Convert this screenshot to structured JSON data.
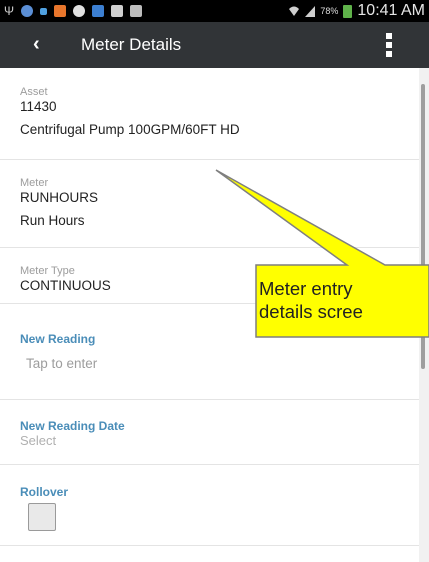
{
  "status_bar": {
    "battery_percent": "78%",
    "time": "10:41 AM",
    "icons": [
      "usb-icon",
      "app-circle-icon",
      "app-square-icon",
      "app-orange-icon",
      "cloud-icon",
      "app-blue-icon",
      "document-icon",
      "image-icon",
      "wifi-icon",
      "signal-icon",
      "battery-icon"
    ]
  },
  "app_bar": {
    "back_glyph": "‹",
    "title": "Meter Details"
  },
  "asset": {
    "label": "Asset",
    "number": "11430",
    "description": "Centrifugal Pump 100GPM/60FT HD"
  },
  "meter": {
    "label": "Meter",
    "code": "RUNHOURS",
    "description": "Run Hours"
  },
  "meter_type": {
    "label": "Meter Type",
    "value": "CONTINUOUS"
  },
  "new_reading": {
    "label": "New Reading",
    "placeholder": "Tap to enter"
  },
  "new_reading_date": {
    "label": "New Reading Date",
    "placeholder": "Select"
  },
  "rollover": {
    "label": "Rollover",
    "checked": false
  },
  "callout": {
    "line1": "Meter entry",
    "line2": "details scree",
    "fill_color": "#ffff00",
    "border_color": "#7f7f7f"
  }
}
